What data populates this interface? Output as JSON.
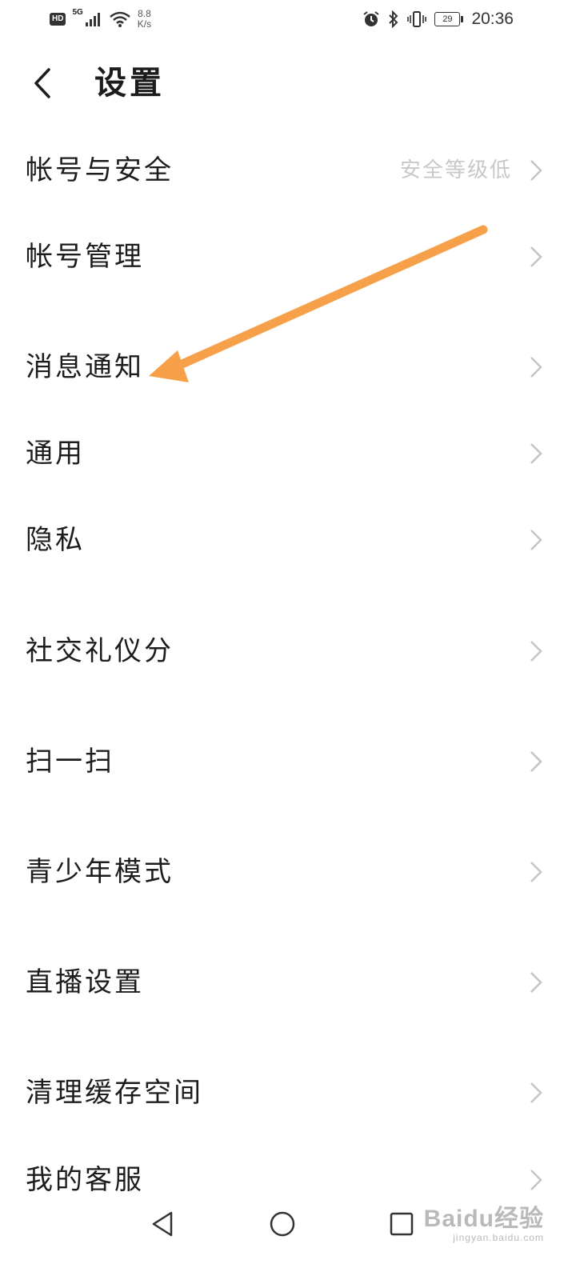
{
  "status_bar": {
    "hd": "HD",
    "network": "5G",
    "speed_value": "8.8",
    "speed_unit": "K/s",
    "battery": "29",
    "time": "20:36"
  },
  "header": {
    "title": "设置"
  },
  "settings": {
    "items": [
      {
        "label": "帐号与安全",
        "value": "安全等级低"
      },
      {
        "label": "帐号管理"
      },
      {
        "label": "消息通知"
      },
      {
        "label": "通用"
      },
      {
        "label": "隐私"
      },
      {
        "label": "社交礼仪分"
      },
      {
        "label": "扫一扫"
      },
      {
        "label": "青少年模式"
      },
      {
        "label": "直播设置"
      },
      {
        "label": "清理缓存空间"
      },
      {
        "label": "我的客服"
      }
    ]
  },
  "watermark": {
    "main": "Baidu经验",
    "sub": "jingyan.baidu.com"
  },
  "colors": {
    "arrow": "#f7a04a",
    "chevron": "#c4c4c4",
    "secondary_text": "#c8c8c8"
  }
}
